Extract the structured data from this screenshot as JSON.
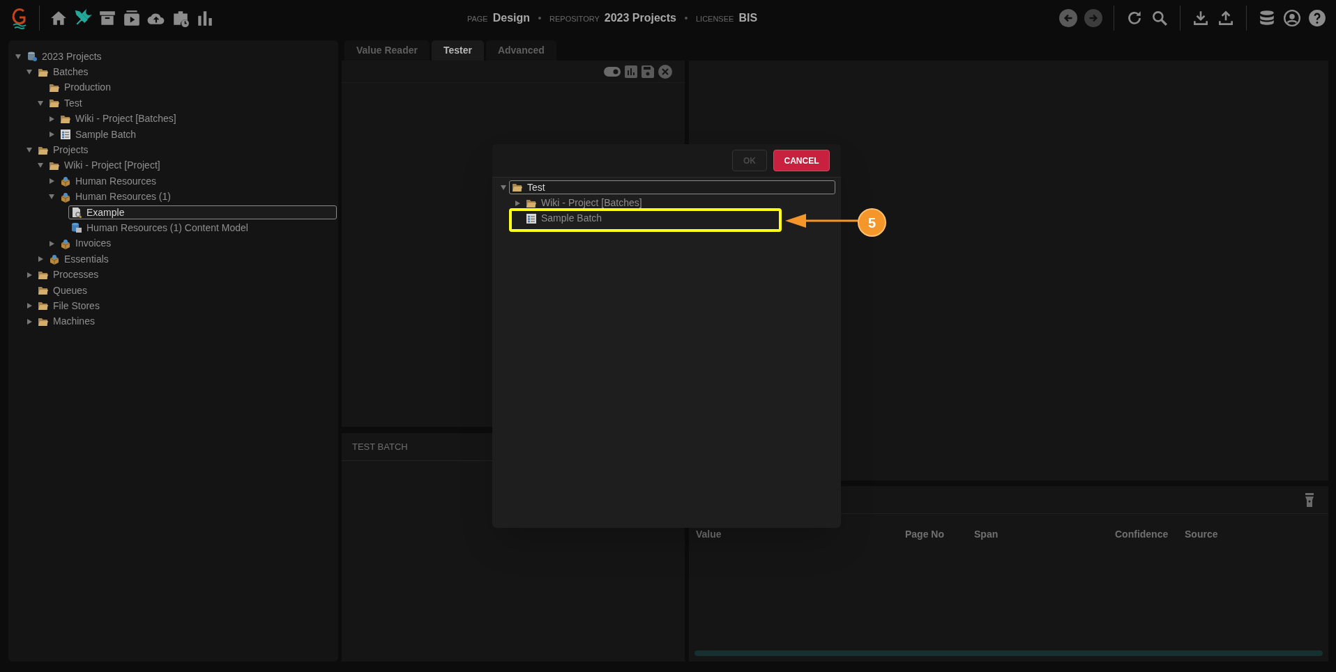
{
  "header": {
    "page_label": "PAGE",
    "page": "Design",
    "repository_label": "REPOSITORY",
    "repository": "2023 Projects",
    "licensee_label": "LICENSEE",
    "licensee": "BIS"
  },
  "tree": [
    {
      "label": "2023 Projects",
      "kind": "repository",
      "expanded": true,
      "selected": false,
      "children": [
        {
          "label": "Batches",
          "kind": "folder",
          "expanded": true,
          "selected": false,
          "children": [
            {
              "label": "Production",
              "kind": "folder",
              "selected": false
            },
            {
              "label": "Test",
              "kind": "folder",
              "expanded": true,
              "selected": false,
              "children": [
                {
                  "label": "Wiki - Project [Batches]",
                  "kind": "folder",
                  "expanded": false,
                  "selected": false
                },
                {
                  "label": "Sample Batch",
                  "kind": "batch",
                  "expanded": false,
                  "selected": false
                }
              ]
            }
          ]
        },
        {
          "label": "Projects",
          "kind": "folder",
          "expanded": true,
          "selected": false,
          "children": [
            {
              "label": "Wiki - Project [Project]",
              "kind": "folder",
              "expanded": true,
              "selected": false,
              "children": [
                {
                  "label": "Human Resources",
                  "kind": "package",
                  "expanded": false,
                  "selected": false
                },
                {
                  "label": "Human Resources (1)",
                  "kind": "package",
                  "expanded": true,
                  "selected": false,
                  "children": [
                    {
                      "label": "Example",
                      "kind": "document",
                      "selected": true
                    },
                    {
                      "label": "Human Resources (1) Content Model",
                      "kind": "model",
                      "selected": false
                    }
                  ]
                },
                {
                  "label": "Invoices",
                  "kind": "package",
                  "expanded": false,
                  "selected": false
                }
              ]
            },
            {
              "label": "Essentials",
              "kind": "package",
              "expanded": false,
              "selected": false
            }
          ]
        },
        {
          "label": "Processes",
          "kind": "folder",
          "expanded": false,
          "selected": false
        },
        {
          "label": "Queues",
          "kind": "folder",
          "selected": false
        },
        {
          "label": "File Stores",
          "kind": "folder",
          "expanded": false,
          "selected": false
        },
        {
          "label": "Machines",
          "kind": "folder",
          "expanded": false,
          "selected": false
        }
      ]
    }
  ],
  "tabs": [
    {
      "label": "Value Reader",
      "selected": false
    },
    {
      "label": "Tester",
      "selected": true
    },
    {
      "label": "Advanced",
      "selected": false
    }
  ],
  "test_batch_panel": {
    "title": "TEST BATCH"
  },
  "results_table": {
    "columns": [
      "Value",
      "Page No",
      "Span",
      "Confidence",
      "Source"
    ]
  },
  "dialog": {
    "buttons": [
      {
        "label": "OK",
        "kind": "ok",
        "disabled": true
      },
      {
        "label": "CANCEL",
        "kind": "cancel",
        "disabled": false
      }
    ],
    "tree": [
      {
        "label": "Test",
        "kind": "folder",
        "expanded": true,
        "selected": true,
        "children": [
          {
            "label": "Wiki - Project [Batches]",
            "kind": "folder",
            "expanded": false,
            "selected": false
          },
          {
            "label": "Sample Batch",
            "kind": "batch",
            "selected": false,
            "highlighted": true
          }
        ]
      }
    ]
  },
  "callout": {
    "number": "5"
  }
}
